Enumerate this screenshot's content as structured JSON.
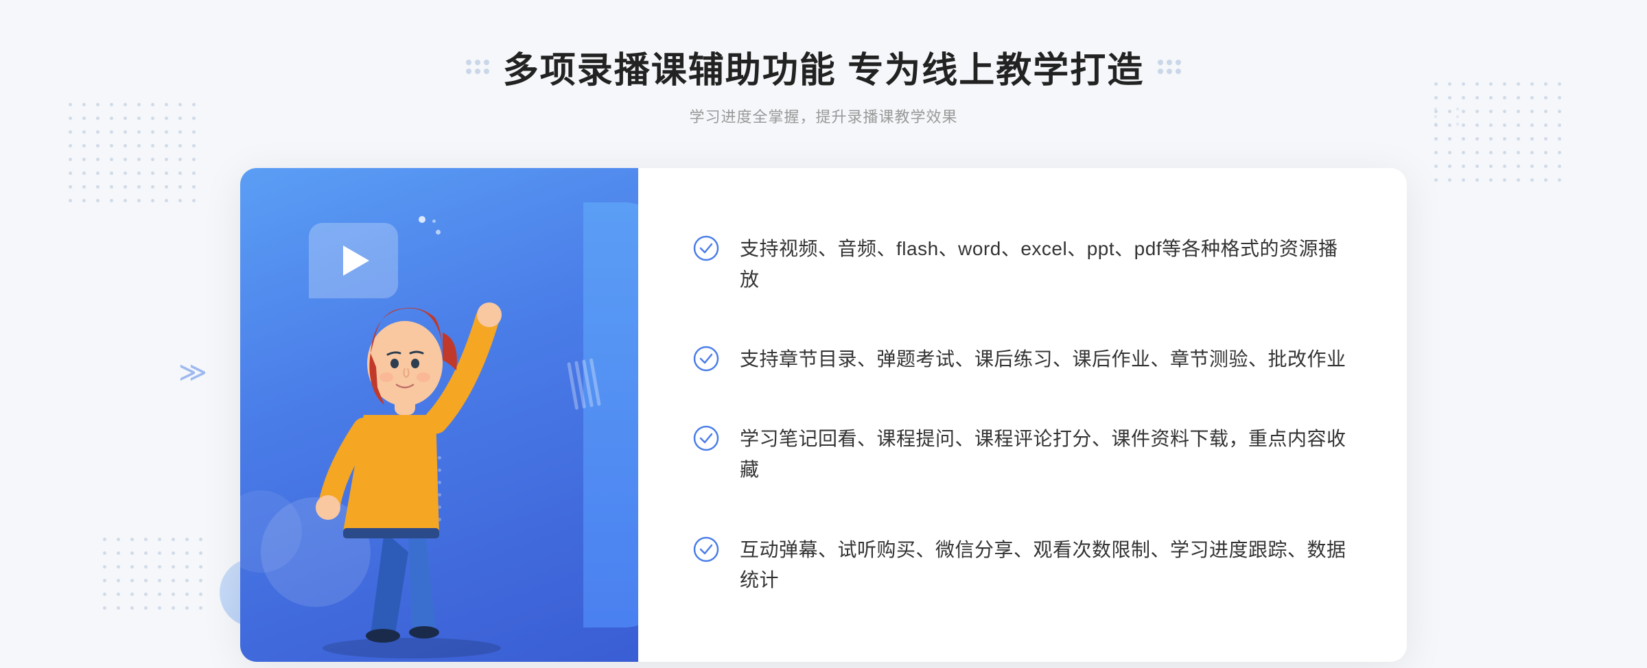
{
  "page": {
    "background_color": "#f5f7fa"
  },
  "header": {
    "main_title": "多项录播课辅助功能 专为线上教学打造",
    "sub_title": "学习进度全掌握，提升录播课教学效果"
  },
  "features": [
    {
      "id": "feature-1",
      "text": "支持视频、音频、flash、word、excel、ppt、pdf等各种格式的资源播放"
    },
    {
      "id": "feature-2",
      "text": "支持章节目录、弹题考试、课后练习、课后作业、章节测验、批改作业"
    },
    {
      "id": "feature-3",
      "text": "学习笔记回看、课程提问、课程评论打分、课件资料下载，重点内容收藏"
    },
    {
      "id": "feature-4",
      "text": "互动弹幕、试听购买、微信分享、观看次数限制、学习进度跟踪、数据统计"
    }
  ],
  "icons": {
    "check": "check-circle-icon",
    "play": "play-icon",
    "arrow_left": "chevron-left-icon",
    "arrow_right": "chevron-right-icon"
  },
  "colors": {
    "primary_blue": "#4a7de8",
    "light_blue": "#5b9ef5",
    "text_dark": "#333333",
    "text_gray": "#999999",
    "check_color": "#4a7de8",
    "background": "#f5f7fa"
  }
}
